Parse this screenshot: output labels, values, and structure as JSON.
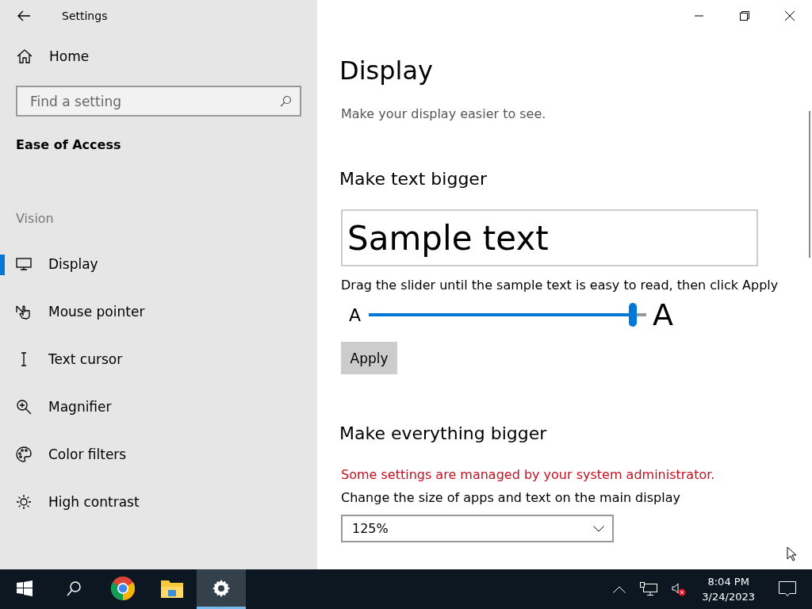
{
  "window": {
    "title": "Settings"
  },
  "sidebar": {
    "home": "Home",
    "search": {
      "placeholder": "Find a setting"
    },
    "category": "Ease of Access",
    "section": "Vision",
    "items": [
      {
        "label": "Display",
        "selected": true
      },
      {
        "label": "Mouse pointer",
        "selected": false
      },
      {
        "label": "Text cursor",
        "selected": false
      },
      {
        "label": "Magnifier",
        "selected": false
      },
      {
        "label": "Color filters",
        "selected": false
      },
      {
        "label": "High contrast",
        "selected": false
      }
    ]
  },
  "content": {
    "title": "Display",
    "subtitle": "Make your display easier to see.",
    "text_size": {
      "heading": "Make text bigger",
      "sample": "Sample text",
      "hint": "Drag the slider until the sample text is easy to read, then click Apply",
      "small_label": "A",
      "large_label": "A",
      "level": 0.95,
      "button": "Apply"
    },
    "scale": {
      "heading": "Make everything bigger",
      "warning": "Some settings are managed by your system administrator.",
      "label": "Change the size of apps and text on the main display",
      "value": "125%"
    }
  },
  "taskbar": {
    "apps": [
      {
        "selected": false
      },
      {
        "selected": false
      },
      {
        "selected": false
      },
      {
        "selected": false
      },
      {
        "selected": true
      }
    ],
    "time": "8:04 PM",
    "date": "3/24/2023"
  }
}
